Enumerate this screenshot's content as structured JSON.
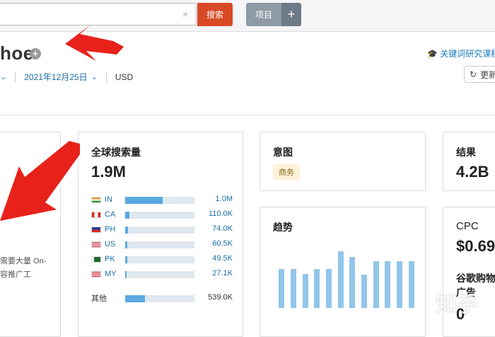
{
  "search": {
    "value": "",
    "clear": "×",
    "button": "搜索"
  },
  "project": {
    "button": "项目",
    "plus": "+"
  },
  "header": {
    "title": "hoe",
    "course_link": "关键词研究课程",
    "date": "2021年12月25日",
    "currency": "USD",
    "update": "更新"
  },
  "global_volume": {
    "title": "全球搜索量",
    "value": "1.9M",
    "rows": [
      {
        "code": "IN",
        "value": "1.0M",
        "fill": 0.54
      },
      {
        "code": "CA",
        "value": "110.0K",
        "fill": 0.06
      },
      {
        "code": "PH",
        "value": "74.0K",
        "fill": 0.04
      },
      {
        "code": "US",
        "value": "60.5K",
        "fill": 0.035
      },
      {
        "code": "PK",
        "value": "49.5K",
        "fill": 0.03
      },
      {
        "code": "MY",
        "value": "27.1K",
        "fill": 0.02
      }
    ],
    "other": {
      "label": "其他",
      "value": "539.0K",
      "fill": 0.29
    }
  },
  "intent": {
    "title": "意图",
    "badge": "商务"
  },
  "trend": {
    "title": "趋势",
    "values": [
      0.69,
      0.69,
      0.6,
      0.69,
      0.69,
      1.0,
      0.9,
      0.59,
      0.82,
      0.82,
      0.82,
      0.82
    ]
  },
  "results": {
    "title": "结果",
    "value": "4.2B"
  },
  "cpc": {
    "title": "CPC",
    "value": "$0.69",
    "shopping_title": "谷歌购物广告",
    "shopping_value": "0"
  },
  "left_card": {
    "line1": "需要大量 On-",
    "line2": "容推广工"
  },
  "watermark": "知乎",
  "colors": {
    "search_button": "#d84a25",
    "project_button": "#8e9aa6",
    "bar": "#5aa9e0",
    "arrow": "#e8221b"
  }
}
